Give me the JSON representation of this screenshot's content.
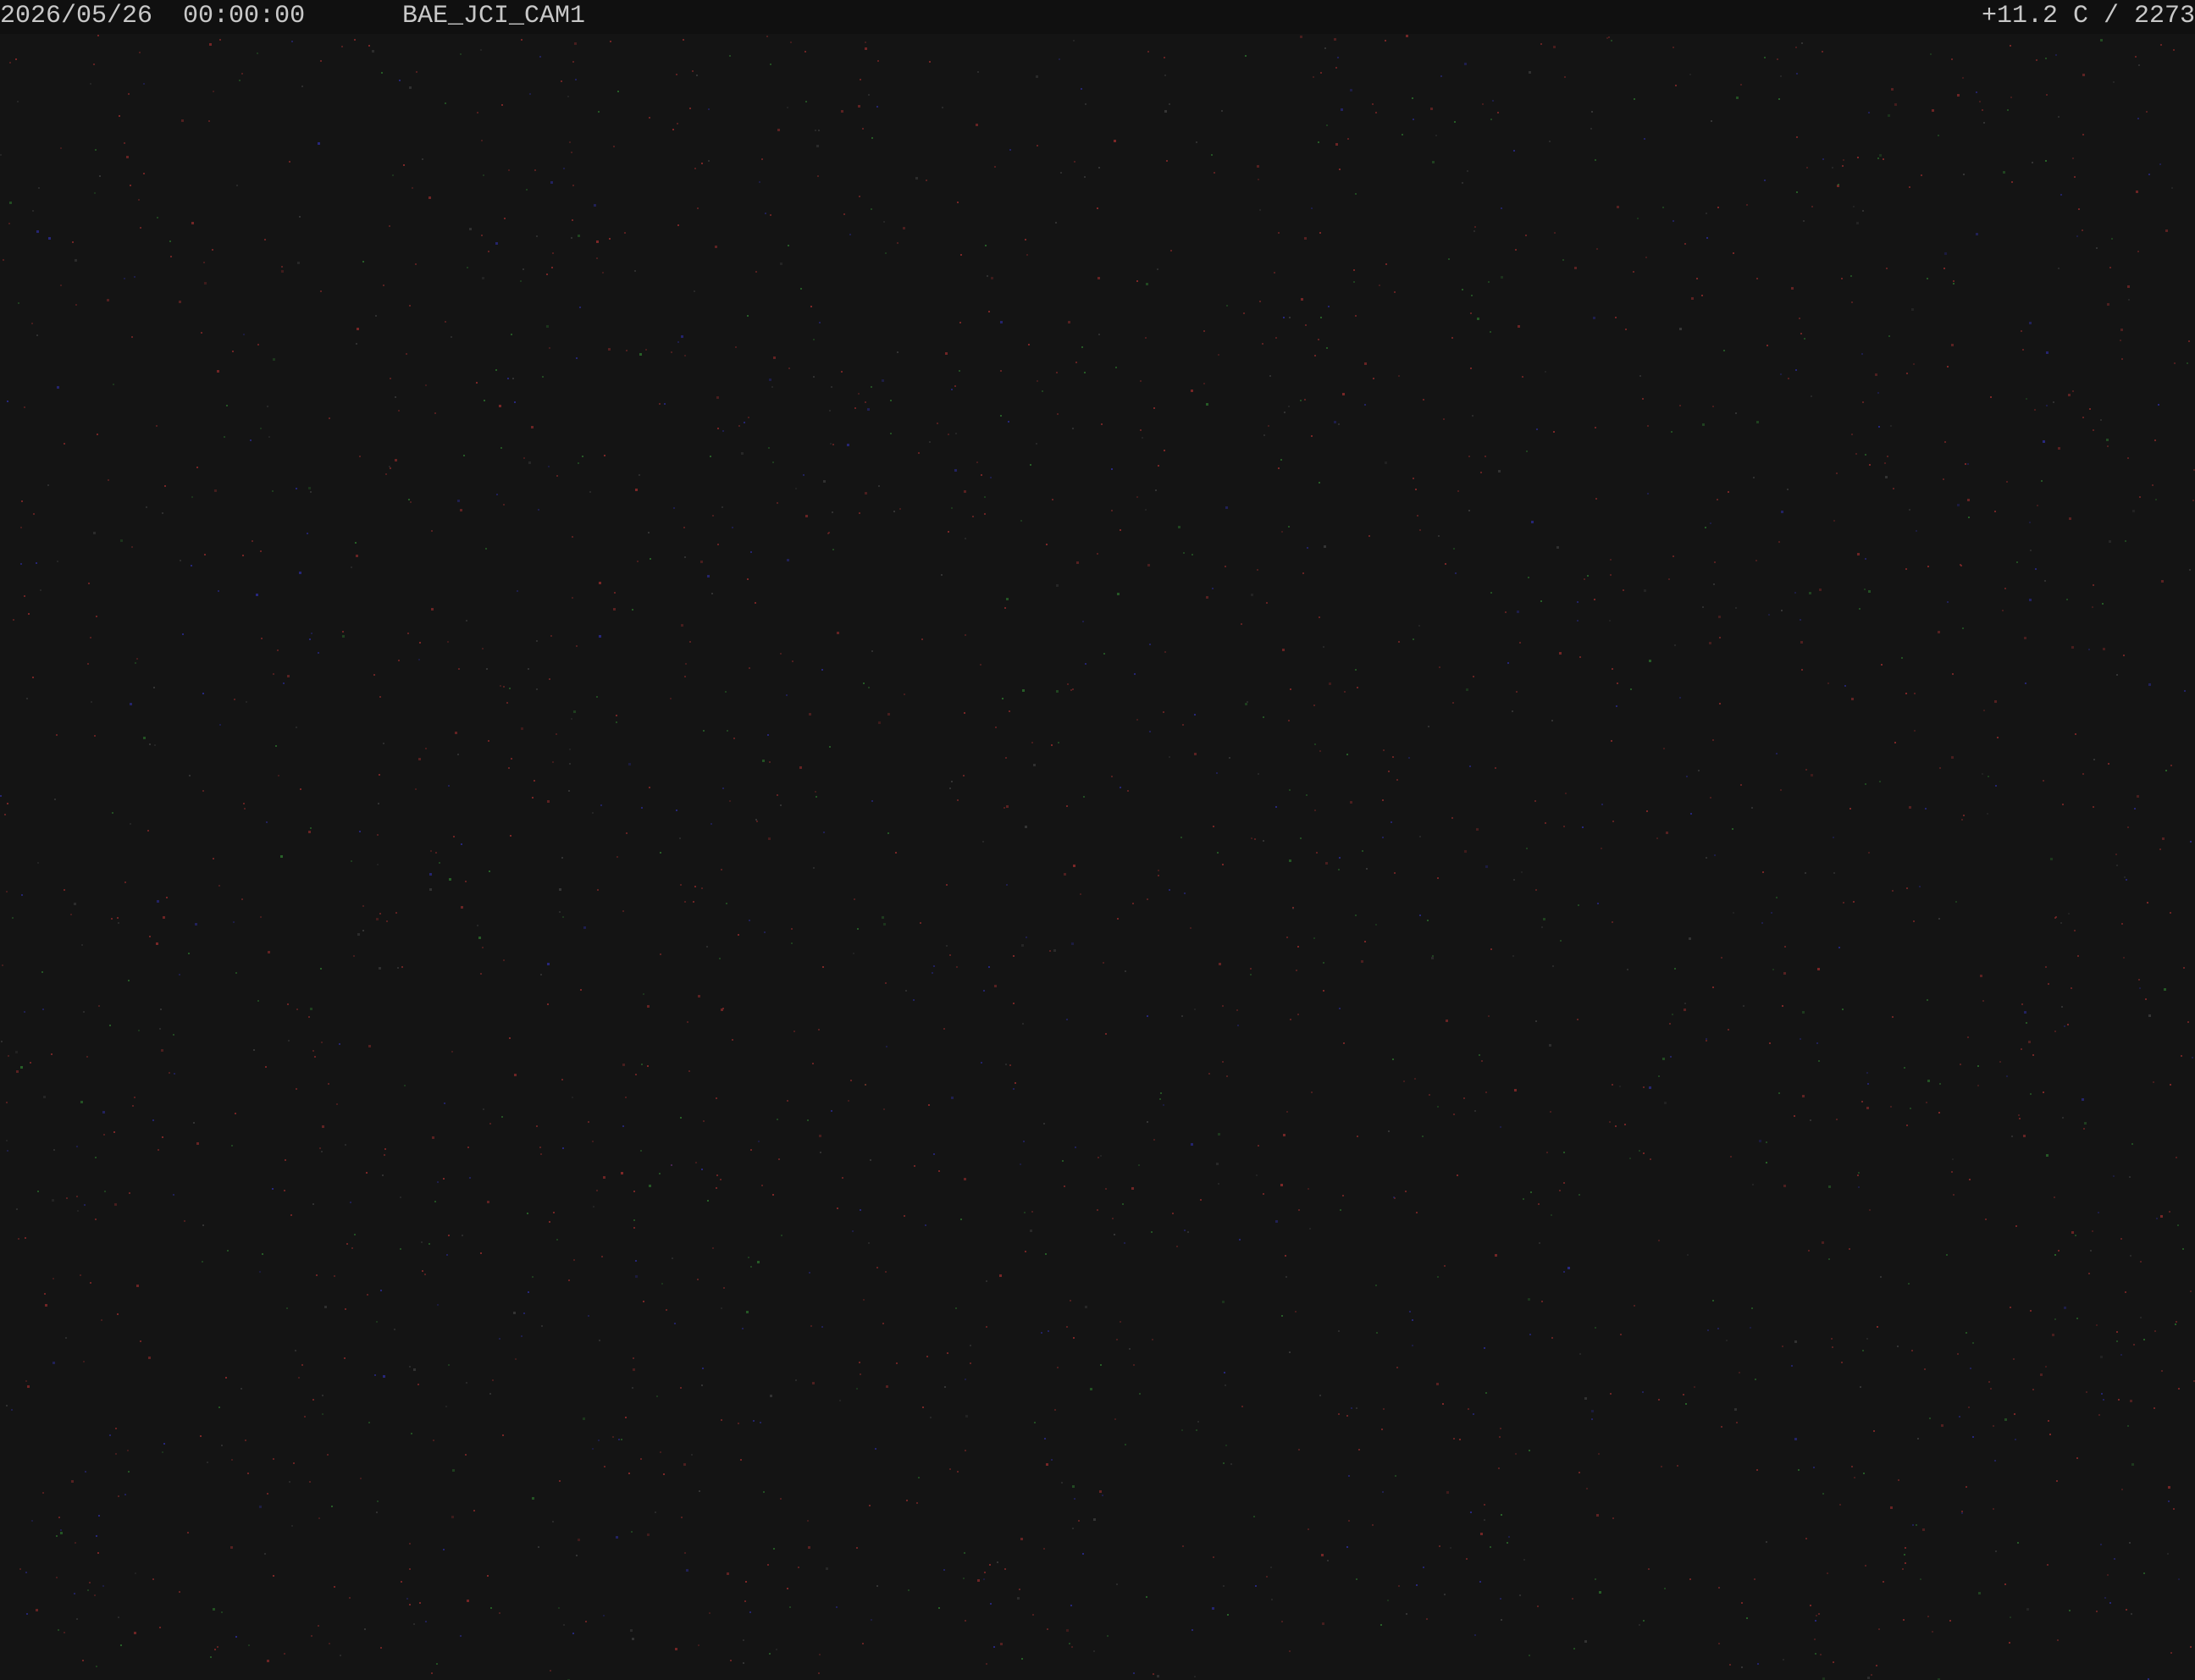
{
  "overlay": {
    "date": "2026/05/26",
    "time": "00:00:00",
    "camera_id": "BAE_JCI_CAM1",
    "temperature": "+11.2 C",
    "counter": "2273"
  },
  "scene": {
    "description_colors": {
      "background": "#141414",
      "overlay_text": "#c8c8c8",
      "noise_red": "#8a2a2a",
      "noise_blue": "#2a2a8a",
      "noise_green": "#2a6a2a"
    }
  }
}
